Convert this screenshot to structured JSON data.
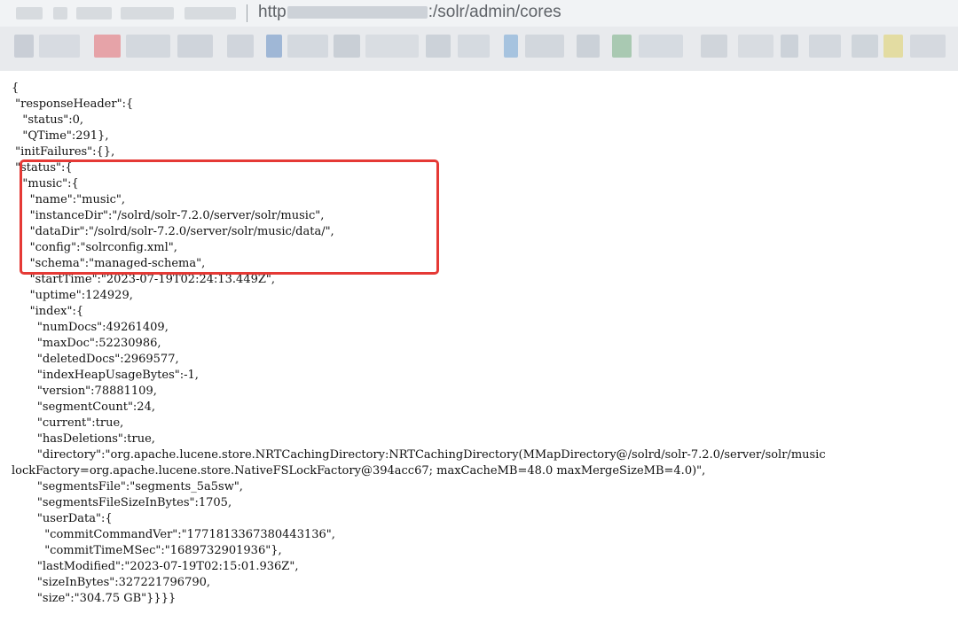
{
  "browser": {
    "address_bar": {
      "prefix": "http",
      "suffix": ":/solr/admin/cores"
    }
  },
  "json_lines": [
    "{",
    " \"responseHeader\":{",
    "   \"status\":0,",
    "   \"QTime\":291},",
    " \"initFailures\":{},",
    " \"status\":{",
    "   \"music\":{",
    "     \"name\":\"music\",",
    "     \"instanceDir\":\"/solrd/solr-7.2.0/server/solr/music\",",
    "     \"dataDir\":\"/solrd/solr-7.2.0/server/solr/music/data/\",",
    "     \"config\":\"solrconfig.xml\",",
    "     \"schema\":\"managed-schema\",",
    "     \"startTime\":\"2023-07-19T02:24:13.449Z\",",
    "     \"uptime\":124929,",
    "     \"index\":{",
    "       \"numDocs\":49261409,",
    "       \"maxDoc\":52230986,",
    "       \"deletedDocs\":2969577,",
    "       \"indexHeapUsageBytes\":-1,",
    "       \"version\":78881109,",
    "       \"segmentCount\":24,",
    "       \"current\":true,",
    "       \"hasDeletions\":true,",
    "       \"directory\":\"org.apache.lucene.store.NRTCachingDirectory:NRTCachingDirectory(MMapDirectory@/solrd/solr-7.2.0/server/solr/music",
    "lockFactory=org.apache.lucene.store.NativeFSLockFactory@394acc67; maxCacheMB=48.0 maxMergeSizeMB=4.0)\",",
    "       \"segmentsFile\":\"segments_5a5sw\",",
    "       \"segmentsFileSizeInBytes\":1705,",
    "       \"userData\":{",
    "         \"commitCommandVer\":\"1771813367380443136\",",
    "         \"commitTimeMSec\":\"1689732901936\"},",
    "       \"lastModified\":\"2023-07-19T02:15:01.936Z\",",
    "       \"sizeInBytes\":327221796790,",
    "       \"size\":\"304.75 GB\"}}}}"
  ]
}
